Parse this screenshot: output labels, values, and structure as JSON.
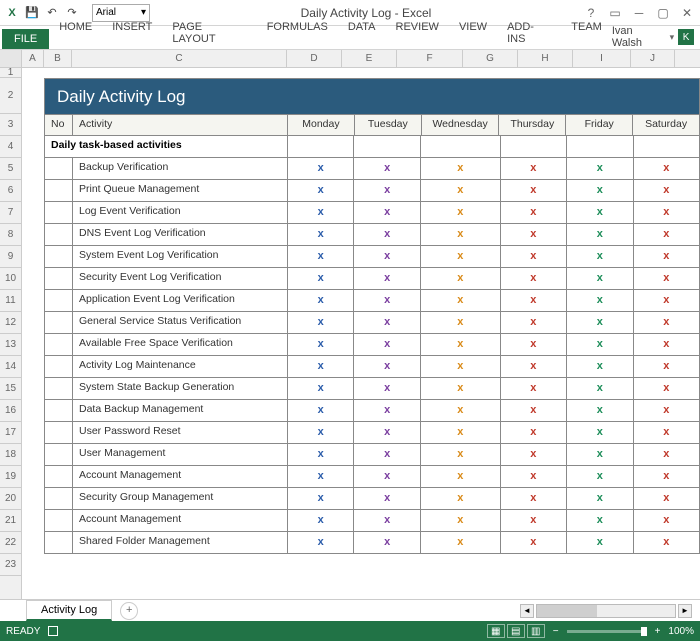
{
  "app": {
    "title": "Daily Activity Log - Excel",
    "font": "Arial"
  },
  "qat": {
    "save": "💾",
    "undo": "↶",
    "redo": "↷"
  },
  "ribbon": {
    "file": "FILE",
    "tabs": [
      "HOME",
      "INSERT",
      "PAGE LAYOUT",
      "FORMULAS",
      "DATA",
      "REVIEW",
      "VIEW",
      "ADD-INS",
      "TEAM"
    ],
    "user": "Ivan Walsh",
    "user_initial": "K"
  },
  "columns": [
    "A",
    "B",
    "C",
    "D",
    "E",
    "F",
    "G",
    "H",
    "I",
    "J"
  ],
  "row_numbers": [
    1,
    2,
    3,
    4,
    5,
    6,
    7,
    8,
    9,
    10,
    11,
    12,
    13,
    14,
    15,
    16,
    17,
    18,
    19,
    20,
    21,
    22,
    23
  ],
  "log": {
    "title": "Daily Activity Log",
    "headers": {
      "no": "No",
      "activity": "Activity",
      "days": [
        "Monday",
        "Tuesday",
        "Wednesday",
        "Thursday",
        "Friday",
        "Saturday"
      ]
    },
    "section": "Daily task-based activities",
    "day_colors": {
      "mon": "#2b5caa",
      "tue": "#7b3fa0",
      "wed": "#d98b1a",
      "thu": "#c0392b",
      "fri": "#1e8e5a",
      "sat": "#c0392b"
    },
    "mark": "x",
    "activities": [
      "Backup Verification",
      "Print Queue Management",
      "Log Event Verification",
      "DNS Event Log Verification",
      "System Event Log Verification",
      "Security Event Log Verification",
      "Application Event Log Verification",
      "General Service Status Verification",
      "Available Free Space Verification",
      "Activity Log Maintenance",
      "System State Backup Generation",
      "Data Backup Management",
      "User Password Reset",
      "User Management",
      "Account Management",
      "Security Group Management",
      "Account Management",
      "Shared Folder Management"
    ]
  },
  "sheet": {
    "tab": "Activity Log",
    "add": "+"
  },
  "status": {
    "ready": "READY",
    "zoom": "100%",
    "minus": "−",
    "plus": "+"
  }
}
